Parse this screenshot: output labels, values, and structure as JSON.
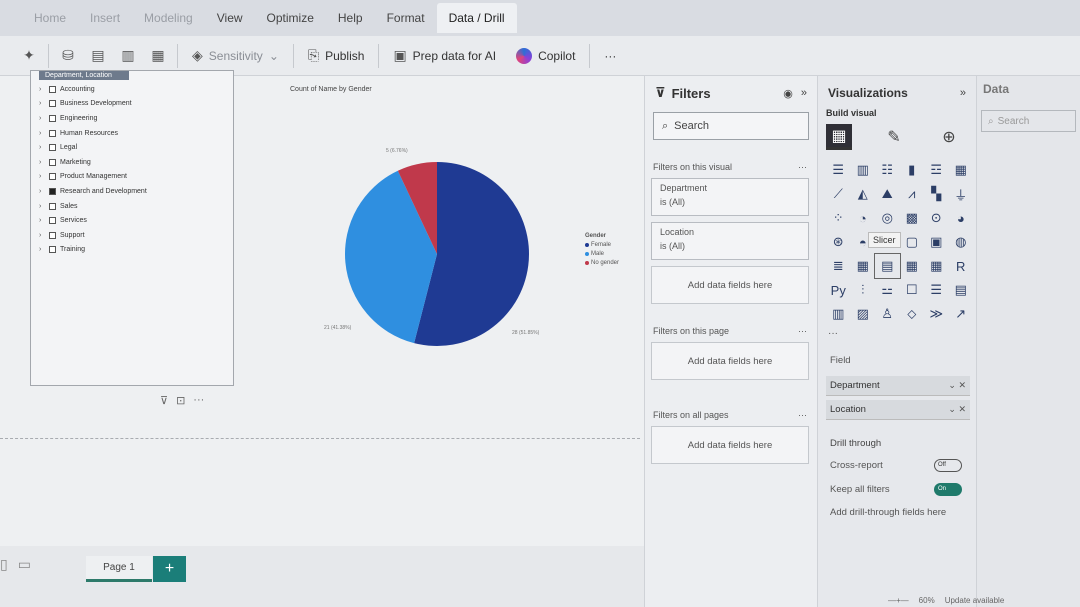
{
  "ribbon": {
    "tabs": [
      {
        "label": "Home"
      },
      {
        "label": "Insert"
      },
      {
        "label": "Modeling"
      },
      {
        "label": "View"
      },
      {
        "label": "Optimize"
      },
      {
        "label": "Help"
      },
      {
        "label": "Format"
      },
      {
        "label": "Data / Drill"
      }
    ]
  },
  "toolbar": {
    "sensitivity": "Sensitivity",
    "publish": "Publish",
    "prep_data": "Prep data for AI",
    "copilot": "Copilot",
    "more": "···"
  },
  "slicer": {
    "title": "Department, Location",
    "items": [
      {
        "label": "Accounting",
        "checked": false
      },
      {
        "label": "Business Development",
        "checked": false
      },
      {
        "label": "Engineering",
        "checked": false
      },
      {
        "label": "Human Resources",
        "checked": false
      },
      {
        "label": "Legal",
        "checked": false
      },
      {
        "label": "Marketing",
        "checked": false
      },
      {
        "label": "Product Management",
        "checked": false
      },
      {
        "label": "Research and Development",
        "checked": true
      },
      {
        "label": "Sales",
        "checked": false
      },
      {
        "label": "Services",
        "checked": false
      },
      {
        "label": "Support",
        "checked": false
      },
      {
        "label": "Training",
        "checked": false
      }
    ]
  },
  "chart_data": {
    "type": "pie",
    "title": "Count of Name by Gender",
    "legend_title": "Gender",
    "legend_position": "right",
    "slices": [
      {
        "label": "Female",
        "value": 54,
        "color": "#1f3a93",
        "data_label": "28 (51.85%)"
      },
      {
        "label": "Male",
        "value": 39,
        "color": "#2f8fe0",
        "data_label": "21 (41.38%)"
      },
      {
        "label": "No gender",
        "value": 7,
        "color": "#c0394b",
        "data_label": "5 (6.76%)"
      }
    ]
  },
  "page_tabs": {
    "pages": [
      "Page 1"
    ],
    "add": "+"
  },
  "filters": {
    "title": "Filters",
    "search_placeholder": "Search",
    "on_visual_label": "Filters on this visual",
    "cards": [
      {
        "name": "Department",
        "value": "is (All)"
      },
      {
        "name": "Location",
        "value": "is (All)"
      }
    ],
    "add_fields": "Add data fields here",
    "on_page_label": "Filters on this page",
    "on_all_pages_label": "Filters on all pages",
    "dots": "···"
  },
  "visualizations": {
    "title": "Visualizations",
    "build_visual": "Build visual",
    "tooltip": "Slicer",
    "more": "···",
    "field_label": "Field",
    "fields": [
      "Department",
      "Location"
    ],
    "drill_title": "Drill through",
    "cross_report": "Cross-report",
    "cross_report_state": "Off",
    "keep_filters": "Keep all filters",
    "keep_filters_state": "On",
    "add_drill": "Add drill-through fields here",
    "icons": [
      "stacked-bar",
      "clustered-column",
      "stacked-bar-100",
      "clustered-column-2",
      "bar-100",
      "column-100",
      "line",
      "area",
      "stacked-area",
      "ribbon",
      "waterfall",
      "funnel",
      "scatter",
      "pie",
      "donut",
      "treemap",
      "map",
      "filled-map",
      "azure-map",
      "gauge",
      "kpi",
      "card",
      "multi-row-card",
      "shape-map",
      "table",
      "matrix",
      "slicer",
      "table-2",
      "matrix-2",
      "r-visual",
      "python",
      "key-influencers",
      "decomposition",
      "qa",
      "narrative",
      "paginated",
      "power-apps",
      "power-automate",
      "trophy",
      "diamond",
      "chevron",
      "arrow"
    ]
  },
  "data_pane": {
    "title": "Data",
    "search_placeholder": "Search"
  },
  "status": {
    "zoom": "60%",
    "note": "Update available"
  }
}
